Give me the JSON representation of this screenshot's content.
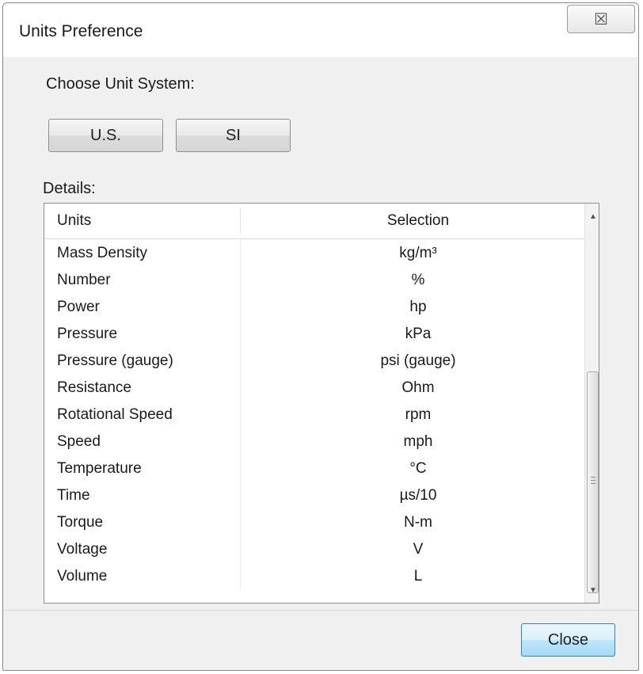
{
  "window": {
    "title": "Units Preference",
    "close_glyph": "☒"
  },
  "unit_system": {
    "label": "Choose Unit System:",
    "us_button": "U.S.",
    "si_button": "SI"
  },
  "details": {
    "label": "Details:",
    "columns": [
      "Units",
      "Selection"
    ],
    "rows": [
      {
        "unit": "Mass Density",
        "selection": "kg/m³"
      },
      {
        "unit": "Number",
        "selection": "%"
      },
      {
        "unit": "Power",
        "selection": "hp"
      },
      {
        "unit": "Pressure",
        "selection": "kPa"
      },
      {
        "unit": "Pressure (gauge)",
        "selection": "psi (gauge)"
      },
      {
        "unit": "Resistance",
        "selection": "Ohm"
      },
      {
        "unit": "Rotational Speed",
        "selection": "rpm"
      },
      {
        "unit": "Speed",
        "selection": "mph"
      },
      {
        "unit": "Temperature",
        "selection": "°C"
      },
      {
        "unit": "Time",
        "selection": "µs/10"
      },
      {
        "unit": "Torque",
        "selection": "N-m"
      },
      {
        "unit": "Voltage",
        "selection": "V"
      },
      {
        "unit": "Volume",
        "selection": "L"
      }
    ]
  },
  "footer": {
    "close_button": "Close"
  },
  "colors": {
    "close_button_border": "#3c7fb1",
    "close_button_fill": "#bee6fd"
  }
}
